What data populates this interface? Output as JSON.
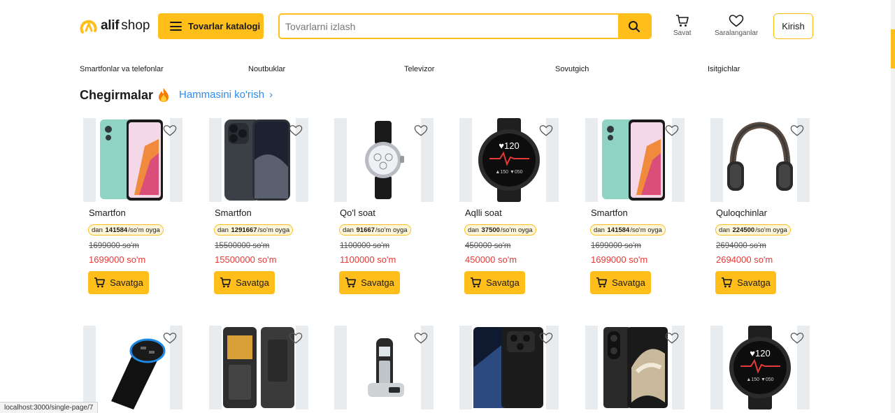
{
  "header": {
    "logo_alif": "alif",
    "logo_shop": "shop",
    "catalog_label": "Tovarlar katalogi",
    "search_placeholder": "Tovarlarni izlash",
    "cart_label": "Savat",
    "favorites_label": "Saralanganlar",
    "login_label": "Kirish"
  },
  "categories": [
    "Smartfonlar va telefonlar",
    "Noutbuklar",
    "Televizor",
    "Sovutgich",
    "Isitgichlar"
  ],
  "section": {
    "title": "Chegirmalar",
    "see_all": "Hammasini ko'rish"
  },
  "products": [
    {
      "name": "Smartfon",
      "installment_prefix": "dan",
      "installment_value": "141584",
      "installment_suffix": "/so'm oyga",
      "old_price": "1699000 so'm",
      "price": "1699000 so'm",
      "button": "Savatga",
      "image": "phone-teal"
    },
    {
      "name": "Smartfon",
      "installment_prefix": "dan",
      "installment_value": "1291667",
      "installment_suffix": "/so'm oyga",
      "old_price": "15500000 so'm",
      "price": "15500000 so'm",
      "button": "Savatga",
      "image": "iphone-titanium"
    },
    {
      "name": "Qo'l soat",
      "installment_prefix": "dan",
      "installment_value": "91667",
      "installment_suffix": "/so'm oyga",
      "old_price": "1100000 so'm",
      "price": "1100000 so'm",
      "button": "Savatga",
      "image": "wrist-watch"
    },
    {
      "name": "Aqlli soat",
      "installment_prefix": "dan",
      "installment_value": "37500",
      "installment_suffix": "/so'm oyga",
      "old_price": "450000 so'm",
      "price": "450000 so'm",
      "button": "Savatga",
      "image": "smart-watch"
    },
    {
      "name": "Smartfon",
      "installment_prefix": "dan",
      "installment_value": "141584",
      "installment_suffix": "/so'm oyga",
      "old_price": "1699000 so'm",
      "price": "1699000 so'm",
      "button": "Savatga",
      "image": "phone-teal"
    },
    {
      "name": "Quloqchinlar",
      "installment_prefix": "dan",
      "installment_value": "224500",
      "installment_suffix": "/so'm oyga",
      "old_price": "2694000 so'm",
      "price": "2694000 so'm",
      "button": "Savatga",
      "image": "headphones"
    }
  ],
  "products_row2": [
    {
      "image": "car-charger"
    },
    {
      "image": "feature-phone"
    },
    {
      "image": "cordless-phone"
    },
    {
      "image": "phone-black"
    },
    {
      "image": "phone-vivo"
    },
    {
      "image": "smart-watch"
    }
  ],
  "status_url": "localhost:3000/single-page/7",
  "colors": {
    "accent": "#ffbe1a",
    "price_red": "#e53935",
    "link_blue": "#2d8cf0",
    "image_bg": "#e9ecef"
  }
}
